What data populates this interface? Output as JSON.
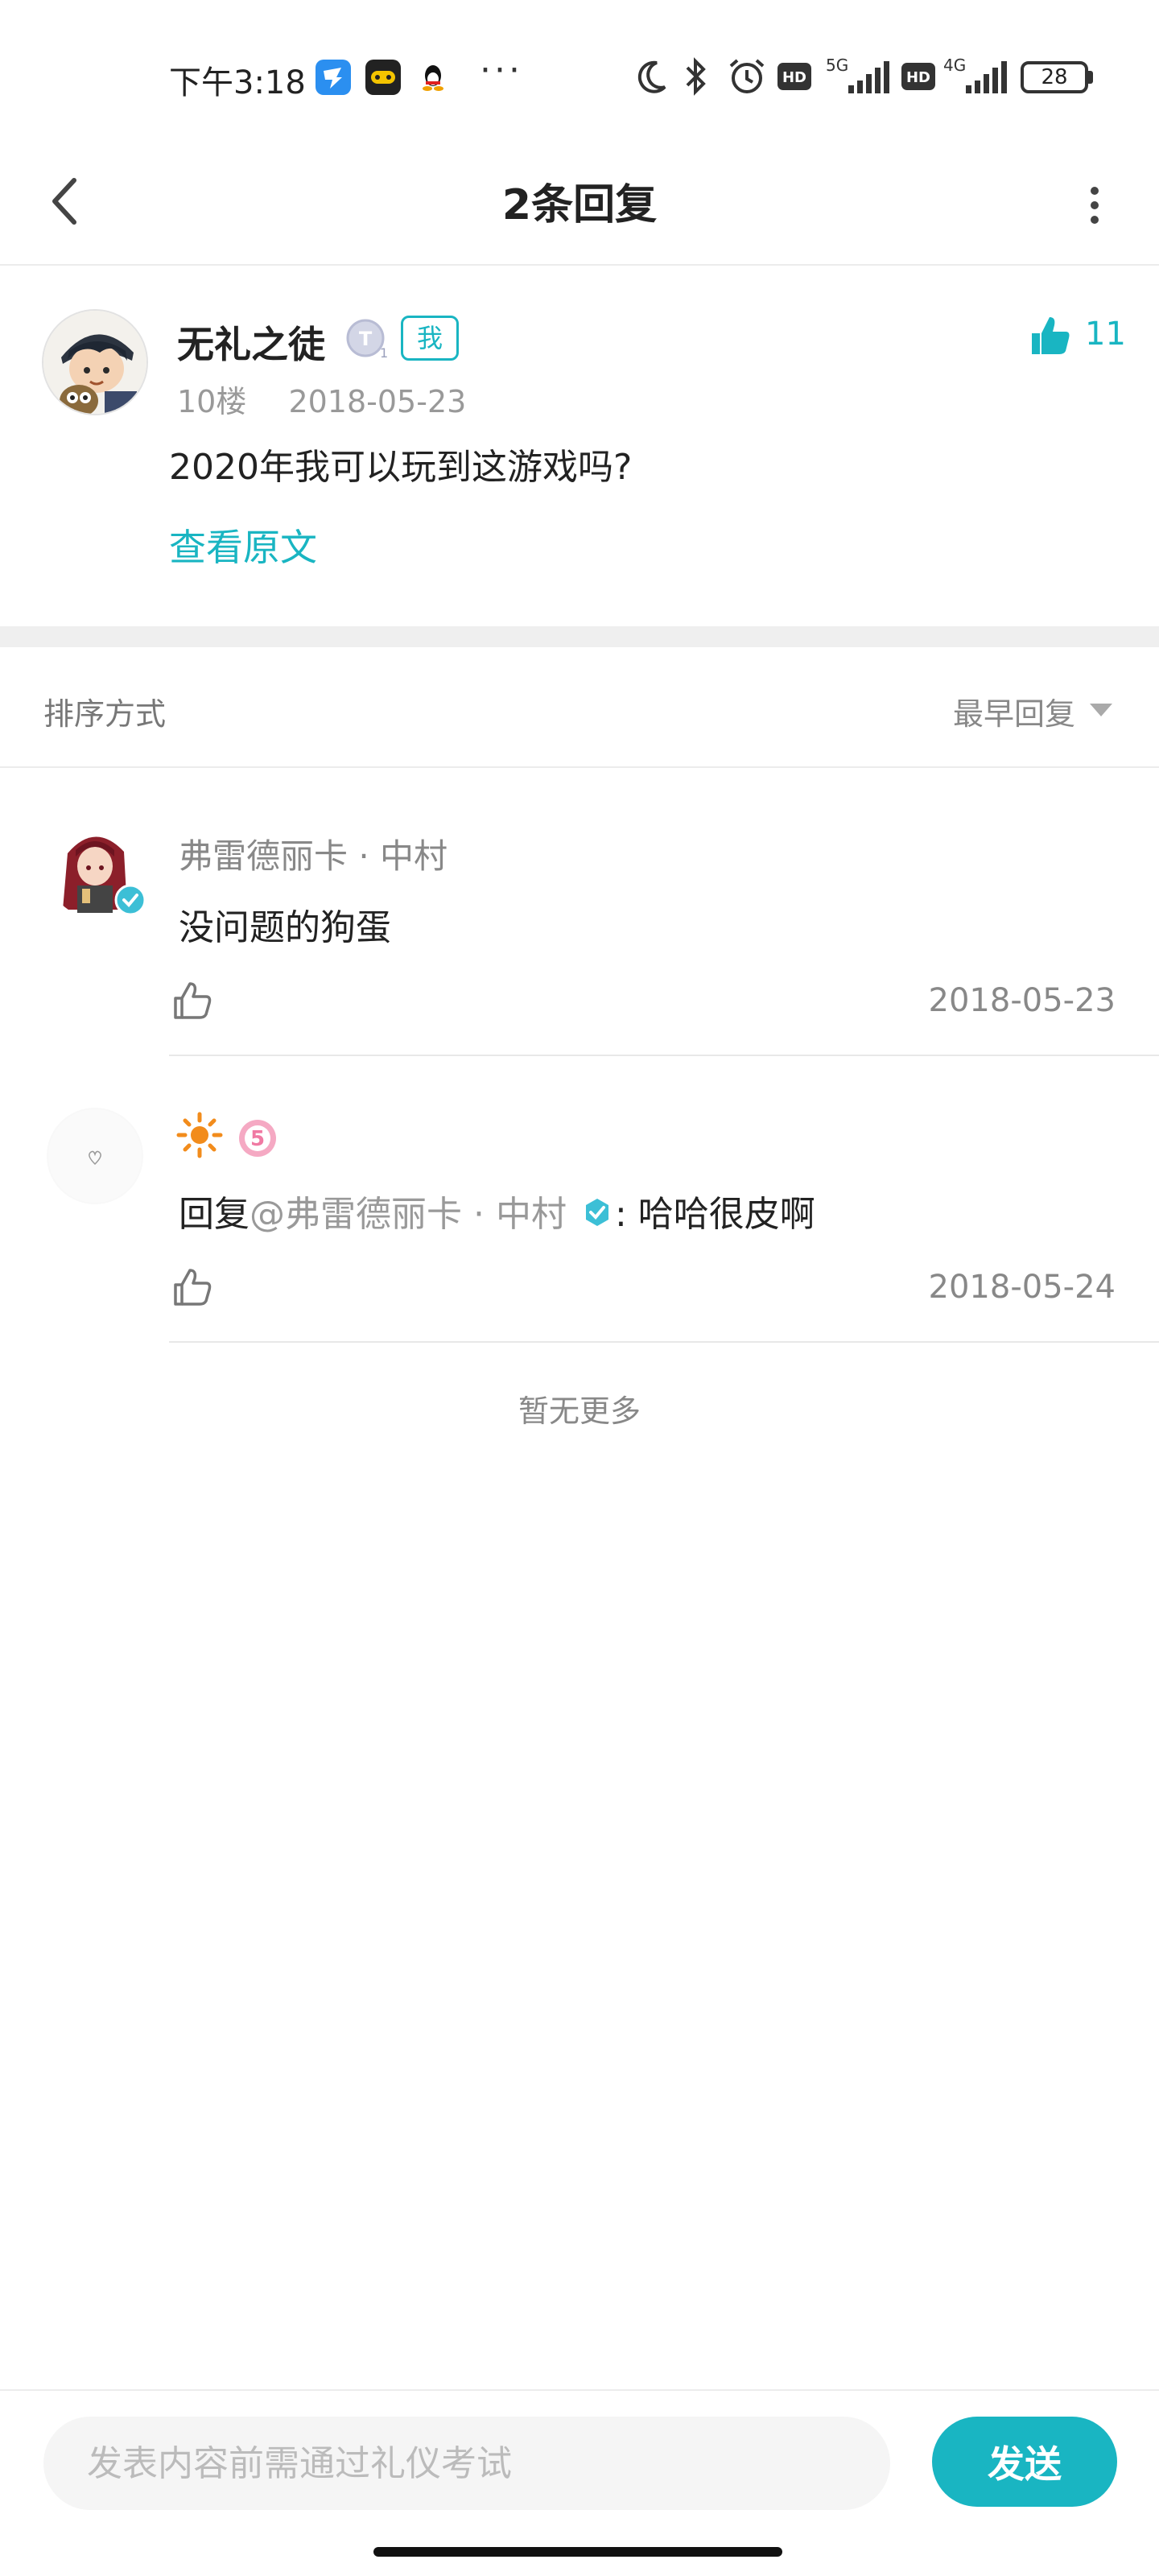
{
  "status_bar": {
    "time": "下午3:18",
    "network_1": "5G",
    "network_2": "4G",
    "battery": "28"
  },
  "header": {
    "title": "2条回复"
  },
  "post": {
    "author": "无礼之徒",
    "level_badge": "T1",
    "me_tag": "我",
    "like_count": "11",
    "floor": "10楼",
    "date": "2018-05-23",
    "content": "2020年我可以玩到这游戏吗?",
    "view_original": "查看原文"
  },
  "sort": {
    "label": "排序方式",
    "value": "最早回复"
  },
  "replies": [
    {
      "author": "弗雷德丽卡 · 中村",
      "text": "没问题的狗蛋",
      "date": "2018-05-23"
    },
    {
      "reply_prefix": "回复",
      "mention": "@弗雷德丽卡 · 中村",
      "text": ": 哈哈很皮啊",
      "date": "2018-05-24"
    }
  ],
  "footer": {
    "no_more": "暂无更多",
    "input_placeholder": "发表内容前需通过礼仪考试",
    "send_label": "发送"
  },
  "colors": {
    "accent": "#19b5c2",
    "text": "#222222",
    "muted": "#888888"
  }
}
